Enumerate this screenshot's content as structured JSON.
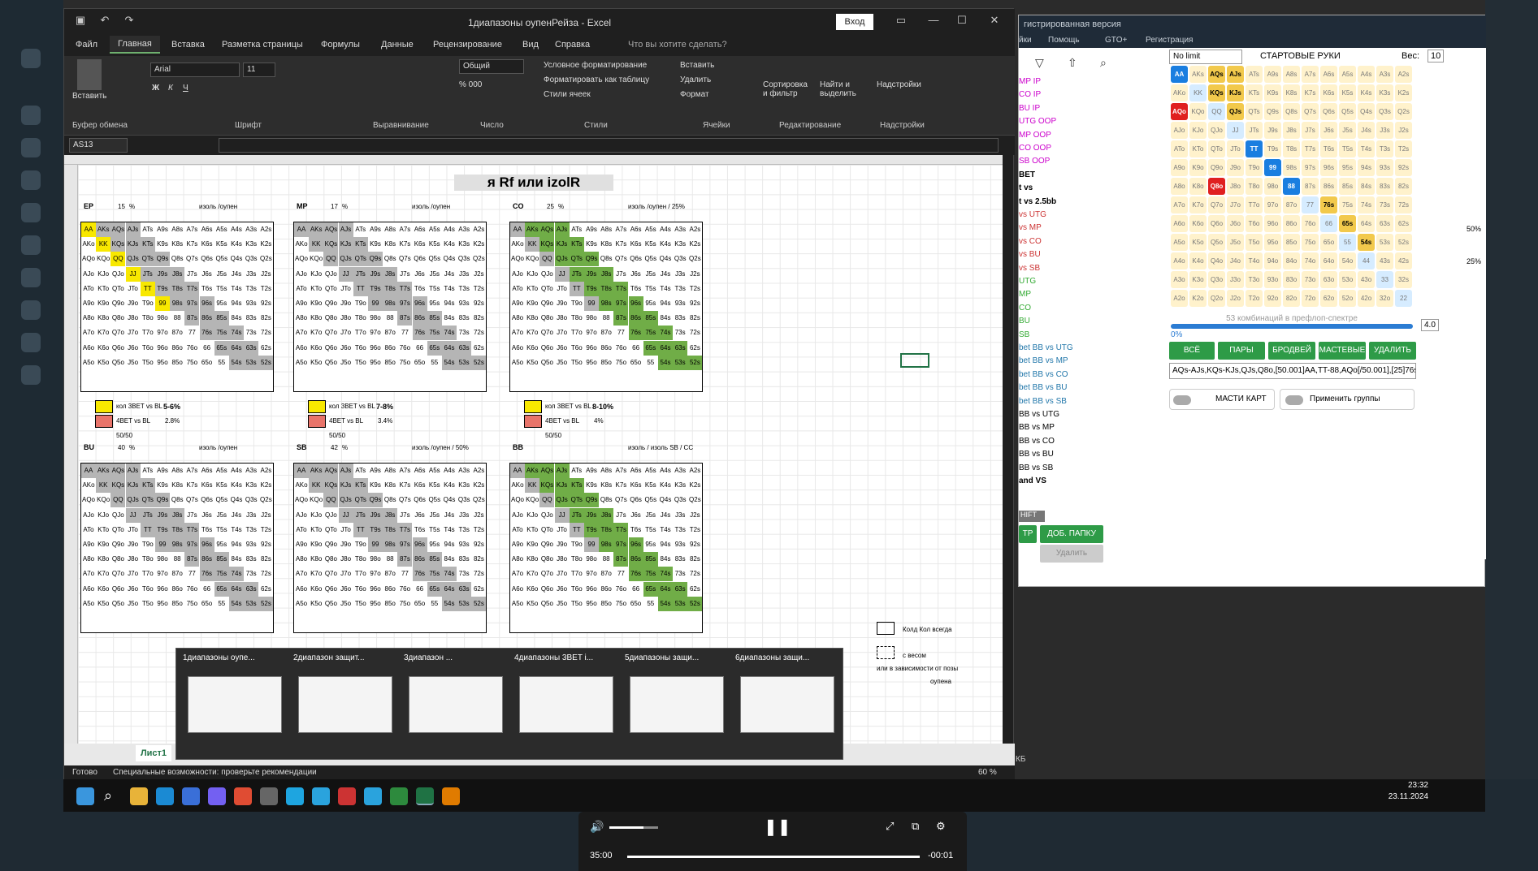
{
  "excel": {
    "title": "1диапазоны оупенРейза  -  Excel",
    "login": "Вход",
    "menu": [
      "Файл",
      "Главная",
      "Вставка",
      "Разметка страницы",
      "Формулы",
      "Данные",
      "Рецензирование",
      "Вид",
      "Справка",
      "Что вы хотите сделать?"
    ],
    "ribbon": {
      "font_name": "Arial",
      "font_size": "11",
      "number_format": "Общий",
      "paste": "Вставить",
      "cond_format": "Условное форматирование",
      "format_table": "Форматировать как таблицу",
      "cell_styles": "Стили ячеек",
      "insert": "Вставить",
      "delete": "Удалить",
      "format": "Формат",
      "sort": "Сортировка и фильтр",
      "find": "Найти и выделить",
      "addins": "Надстройки",
      "groups": [
        "Буфер обмена",
        "Шрифт",
        "Выравнивание",
        "Число",
        "Стили",
        "Ячейки",
        "Редактирование",
        "Надстройки"
      ]
    },
    "name_box": "AS13",
    "sheet_title": "я Rf или izolR",
    "blocks": [
      {
        "pos": "EP",
        "pct": "15",
        "unit": "%",
        "izol": "изоль /оупен",
        "pct3": "5-6%",
        "pct4": "2.8%",
        "l1": "кол 3BET vs BL",
        "l2": "4BET vs BL",
        "l3": "50/50"
      },
      {
        "pos": "MP",
        "pct": "17",
        "unit": "%",
        "izol": "изоль /оупен",
        "pct3": "7-8%",
        "pct4": "3.4%",
        "l1": "кол 3BET vs BL",
        "l2": "4BET vs BL",
        "l3": "50/50"
      },
      {
        "pos": "CO",
        "pct": "25",
        "unit": "%",
        "izol": "изоль /оупен / 25%",
        "pct3": "8-10%",
        "pct4": "4%",
        "l1": "кол 3BET vs BL",
        "l2": "4BET vs BL",
        "l3": "50/50"
      },
      {
        "pos": "BU",
        "pct": "40",
        "unit": "%",
        "izol": "изоль /оупен"
      },
      {
        "pos": "SB",
        "pct": "42",
        "unit": "%",
        "izol": "изоль /оупен / 50%"
      },
      {
        "pos": "BB",
        "pct": "",
        "unit": "",
        "izol": "изоль / изоль SB / СС"
      }
    ],
    "legend": {
      "a": "Колд Кол всегда",
      "b": "с весом",
      "c": "или в зависимости от позы",
      "d": "оупена"
    },
    "sheet_tab": "Лист1",
    "status": "Готово",
    "accessibility": "Специальные возможности: проверьте рекомендации",
    "zoom": "60 %"
  },
  "thumbnails": [
    "1диапазоны оупе...",
    "2диапазон защит...",
    "3диапазон ...",
    "4диапазоны 3BET i...",
    "5диапазоны защи...",
    "6диапазоны защи..."
  ],
  "poker": {
    "title": "гистрированная версия",
    "menu": [
      "йки",
      "Помощь",
      "GTO+",
      "Регистрация"
    ],
    "mode": "No limit",
    "section": "СТАРТОВЫЕ РУКИ",
    "weight_label": "Вес:",
    "weight_value": "10",
    "list": [
      "MP IP",
      "CO IP",
      "BU IP",
      "UTG OOP",
      "MP OOP",
      "CO OOP",
      "SB OOP",
      "BET",
      "t vs",
      "t vs 2.5bb",
      "vs UTG",
      "vs MP",
      "vs CO",
      "vs BU",
      "vs SB",
      "UTG",
      "MP",
      "CO",
      "BU",
      "SB",
      "bet BB vs UTG",
      "bet BB vs MP",
      "bet BB vs CO",
      "bet BB vs BU",
      "bet BB vs SB",
      "BB vs UTG",
      "BB vs MP",
      "BB vs CO",
      "BB vs BU",
      "BB vs SB",
      "and VS"
    ],
    "combos": "53 комбинаций в префлоп-спектре",
    "pct": "0%",
    "side_value": "4.0",
    "buttons": [
      "ВСЁ",
      "ПАРЫ",
      "БРОДВЕЙ",
      "МАСТЕВЫЕ",
      "УДАЛИТЬ"
    ],
    "range_text": "AQs-AJs,KQs-KJs,QJs,Q8o,[50.001]AA,TT-88,AQo[/50.001],[25]76s",
    "suits_toggle": "МАСТИ КАРТ",
    "groups_toggle": "Применить группы",
    "shift": "HIFT",
    "tr": "ТР",
    "add_folder": "ДОБ. ПАПКУ",
    "delete": "Удалить",
    "pct_side1": "50%",
    "pct_side2": "25%"
  },
  "clock": {
    "time": "23:32",
    "date": "23.11.2024"
  },
  "media": {
    "elapsed": "35:00",
    "remaining": "-00:01"
  },
  "tray": "КБ"
}
